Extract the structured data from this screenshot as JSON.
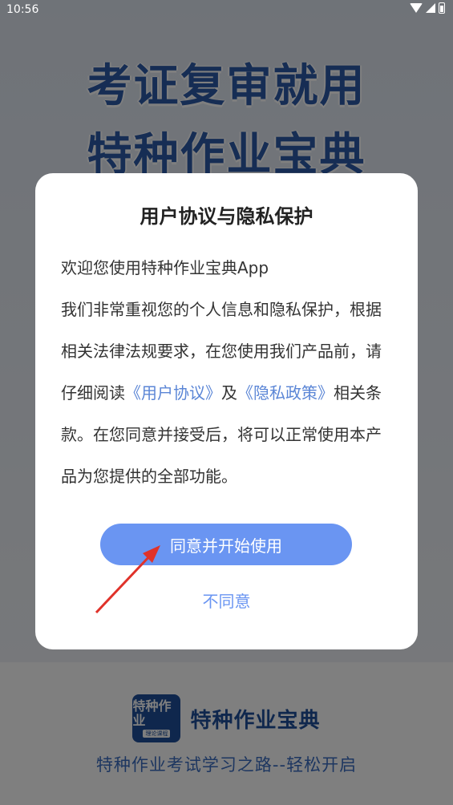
{
  "status_bar": {
    "time": "10:56",
    "icons": [
      "wifi-icon",
      "signal-icon",
      "battery-icon"
    ]
  },
  "splash": {
    "hero_line_1": "考证复审就用",
    "hero_line_2": "特种作业宝典",
    "logo_text": "特种作业",
    "logo_subtext": "理论课程",
    "brand_name": "特种作业宝典",
    "slogan": "特种作业考试学习之路--轻松开启"
  },
  "dialog": {
    "title": "用户协议与隐私保护",
    "welcome": "欢迎您使用特种作业宝典App",
    "body_part_1": "我们非常重视您的个人信息和隐私保护，根据相关法律法规要求，在您使用我们产品前，请仔细阅读",
    "user_agreement_link": "《用户协议》",
    "and_text": "及",
    "privacy_policy_link": "《隐私政策》",
    "body_part_2": "相关条款。在您同意并接受后，将可以正常使用本产品为您提供的全部功能。",
    "agree_button": "同意并开始使用",
    "disagree_button": "不同意"
  },
  "colors": {
    "accent": "#6a95f2",
    "link": "#5b86d6",
    "annotation_arrow": "#e0322a"
  }
}
